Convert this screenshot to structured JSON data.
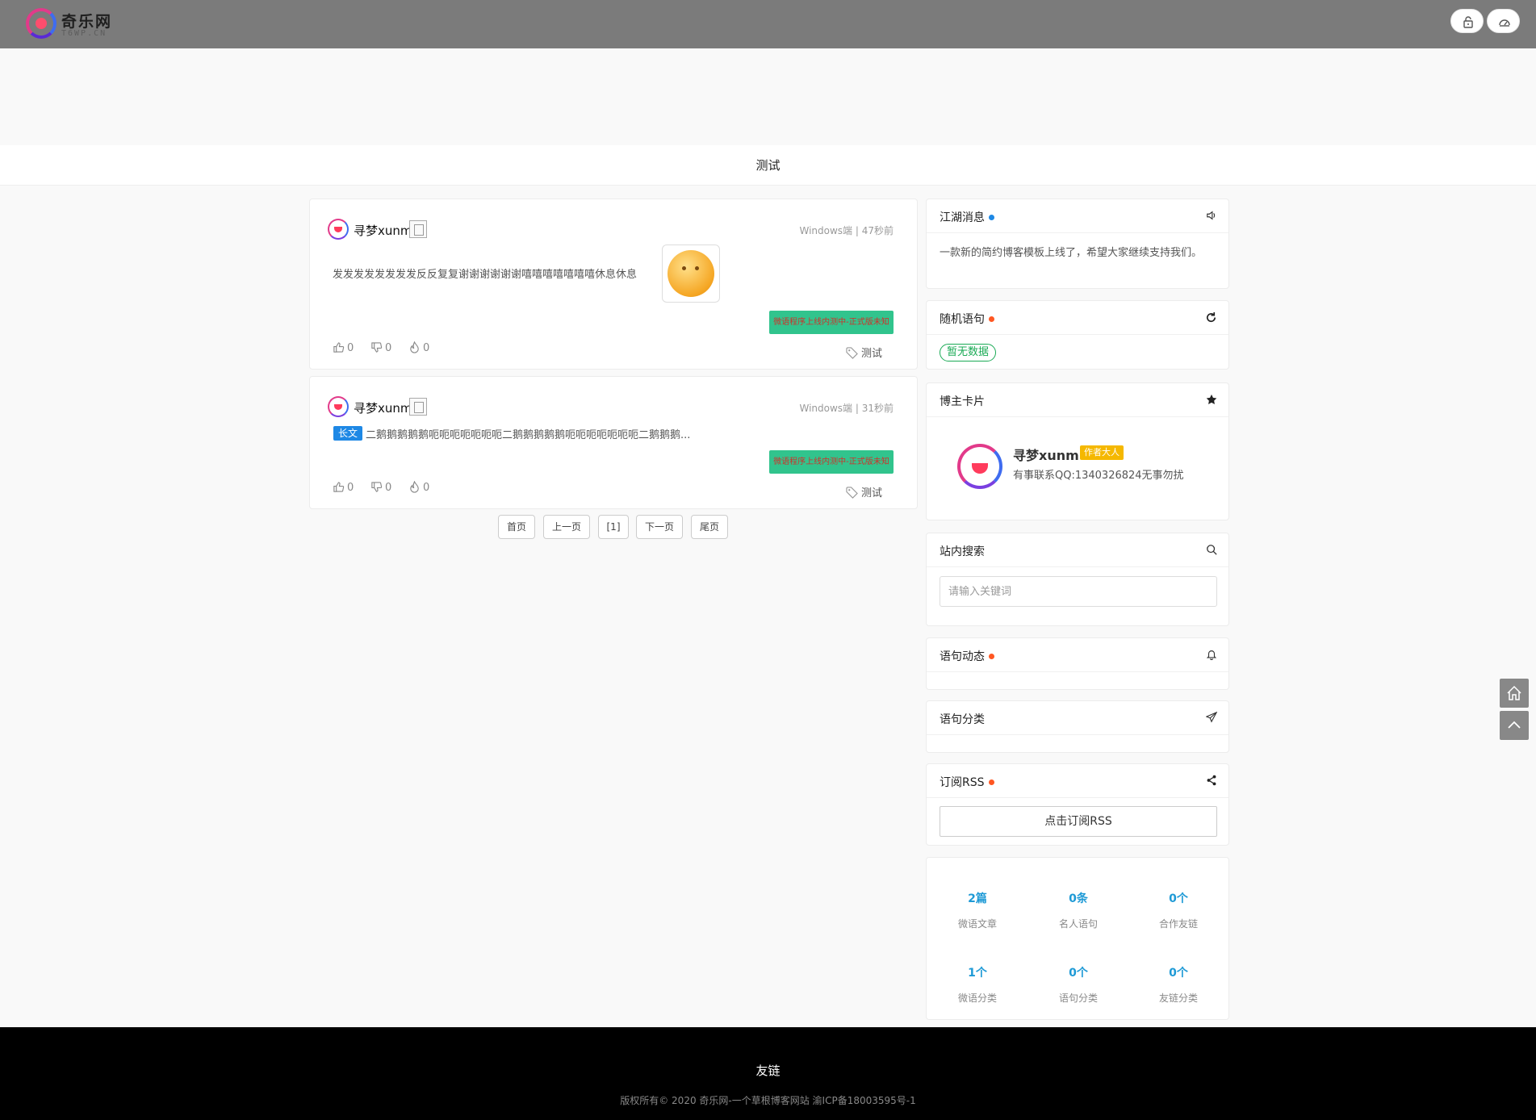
{
  "header": {
    "logo_title": "奇乐网",
    "logo_sub": "T6WP.CN"
  },
  "page_title": "测试",
  "posts": [
    {
      "author": "寻梦xunm",
      "meta": "Windows端 | 47秒前",
      "text": "发发发发发发发发反反复复谢谢谢谢谢谢嘻嘻嘻嘻嘻嘻嘻休息休息",
      "notice": "微语程序上线内测中-正式版未知",
      "likes": "0",
      "dislikes": "0",
      "hot": "0",
      "tag": "测试"
    },
    {
      "author": "寻梦xunm",
      "meta": "Windows端 | 31秒前",
      "long_label": "长文",
      "text": "二鹅鹅鹅鹅鹅呃呃呃呃呃呃呃二鹅鹅鹅鹅鹅呃呃呃呃呃呃呃二鹅鹅鹅...",
      "notice": "微语程序上线内测中-正式版未知",
      "likes": "0",
      "dislikes": "0",
      "hot": "0",
      "tag": "测试"
    }
  ],
  "pagination": [
    "首页",
    "上一页",
    "[1]",
    "下一页",
    "尾页"
  ],
  "sidebar": {
    "news": {
      "title": "江湖消息",
      "text": "一款新的简约博客模板上线了，希望大家继续支持我们。"
    },
    "random": {
      "title": "随机语句",
      "empty": "暂无数据"
    },
    "blogger": {
      "title": "博主卡片",
      "name": "寻梦xunm",
      "badge": "作者大人",
      "desc": "有事联系QQ:1340326824无事勿扰"
    },
    "search": {
      "title": "站内搜索",
      "placeholder": "请输入关键词"
    },
    "dynamic": {
      "title": "语句动态"
    },
    "category": {
      "title": "语句分类"
    },
    "rss": {
      "title": "订阅RSS",
      "button": "点击订阅RSS"
    },
    "stats": [
      {
        "value": "2篇",
        "label": "微语文章"
      },
      {
        "value": "0条",
        "label": "名人语句"
      },
      {
        "value": "0个",
        "label": "合作友链"
      },
      {
        "value": "1个",
        "label": "微语分类"
      },
      {
        "value": "0个",
        "label": "语句分类"
      },
      {
        "value": "0个",
        "label": "友链分类"
      }
    ]
  },
  "footer": {
    "title": "友链",
    "copyright": "版权所有© 2020 奇乐网-一个草根博客网站 渝ICP备18003595号-1"
  },
  "colors": {
    "topbar": "#7b7b7b",
    "accent_blue": "#1e9ad6",
    "notice_green": "#31c48d",
    "dot_red": "#ff5722",
    "dot_blue": "#1e88e5"
  }
}
